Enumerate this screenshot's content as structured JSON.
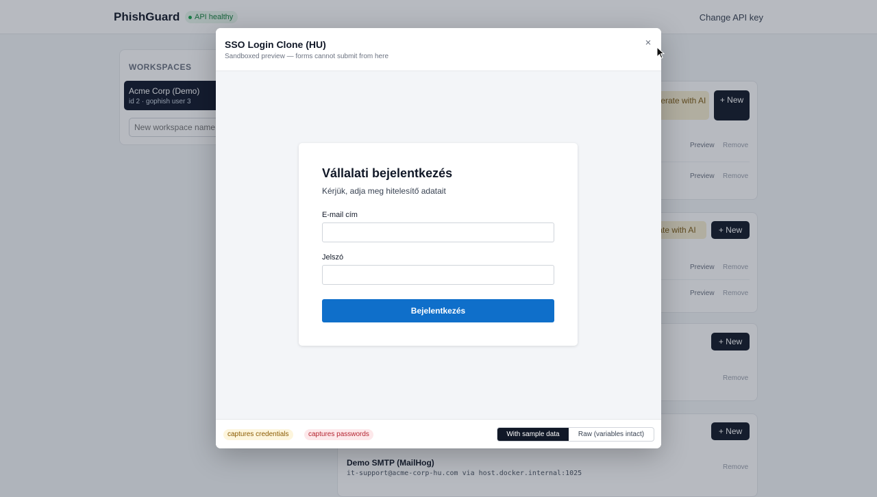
{
  "app": {
    "brand": "PhishGuard",
    "api_status": "API healthy",
    "change_api_key": "Change API key"
  },
  "sidebar": {
    "title": "WORKSPACES",
    "workspace": {
      "name": "Acme Corp (Demo)",
      "meta": "id 2 · gophish user 3"
    },
    "new_workspace_placeholder": "New workspace name"
  },
  "sections": {
    "generate_ai_short": "nerate with AI",
    "generate_ai_long": "ate with AI",
    "new_label": "+ New",
    "preview_label": "Preview",
    "remove_label": "Remove",
    "smtp": {
      "name": "Demo SMTP (MailHog)",
      "meta": "it-support@acme-corp-hu.com via host.docker.internal:1025"
    }
  },
  "modal": {
    "title": "SSO Login Clone (HU)",
    "subtitle": "Sandboxed preview — forms cannot submit from here",
    "close_glyph": "×",
    "preview": {
      "heading": "Vállalati bejelentkezés",
      "subheading": "Kérjük, adja meg hitelesítő adatait",
      "email_label": "E-mail cím",
      "password_label": "Jelszó",
      "submit_label": "Bejelentkezés"
    },
    "badges": {
      "credentials": "captures credentials",
      "passwords": "captures passwords"
    },
    "view_toggle": {
      "sample": "With sample data",
      "raw": "Raw (variables intact)"
    }
  },
  "colors": {
    "primary_button": "#0f6fca",
    "dark": "#111827",
    "health_green": "#16a34a"
  }
}
